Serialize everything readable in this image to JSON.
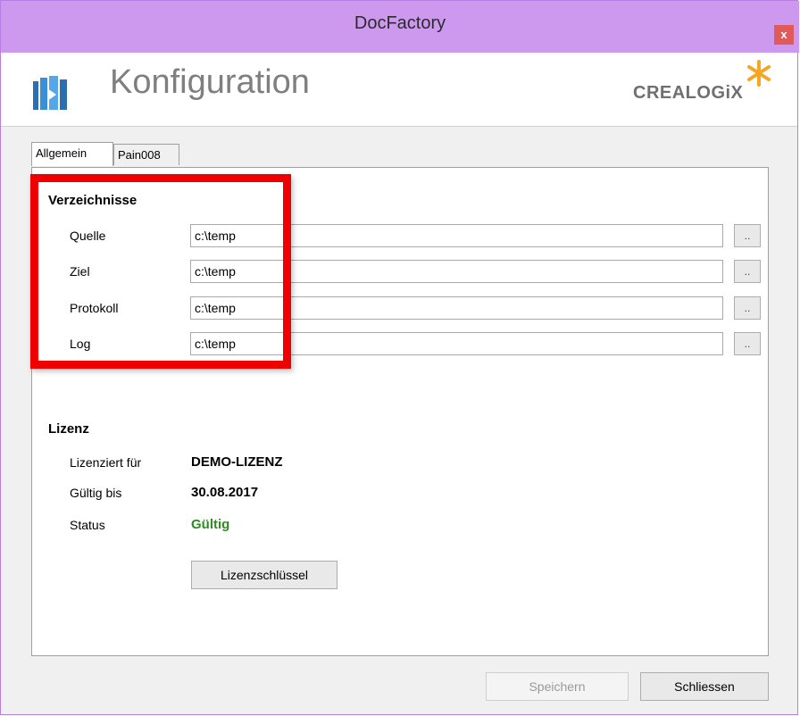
{
  "window": {
    "title": "DocFactory",
    "close_label": "x"
  },
  "header": {
    "title": "Konfiguration",
    "logo_text": "CREALOGiX"
  },
  "tabs": [
    {
      "label": "Allgemein"
    },
    {
      "label": "Pain008"
    }
  ],
  "verzeichnisse": {
    "title": "Verzeichnisse",
    "rows": [
      {
        "label": "Quelle",
        "value": "c:\\temp",
        "browse": ".."
      },
      {
        "label": "Ziel",
        "value": "c:\\temp",
        "browse": ".."
      },
      {
        "label": "Protokoll",
        "value": "c:\\temp",
        "browse": ".."
      },
      {
        "label": "Log",
        "value": "c:\\temp",
        "browse": ".."
      }
    ]
  },
  "lizenz": {
    "title": "Lizenz",
    "licensed_for_label": "Lizenziert für",
    "licensed_for_value": "DEMO-LIZENZ",
    "valid_until_label": "Gültig bis",
    "valid_until_value": "30.08.2017",
    "status_label": "Status",
    "status_value": "Gültig",
    "key_button": "Lizenzschlüssel"
  },
  "footer": {
    "save_label": "Speichern",
    "close_label": "Schliessen"
  },
  "colors": {
    "titlebar": "#cc99ee",
    "highlight": "#ef0000",
    "status_ok": "#2e8b22"
  }
}
